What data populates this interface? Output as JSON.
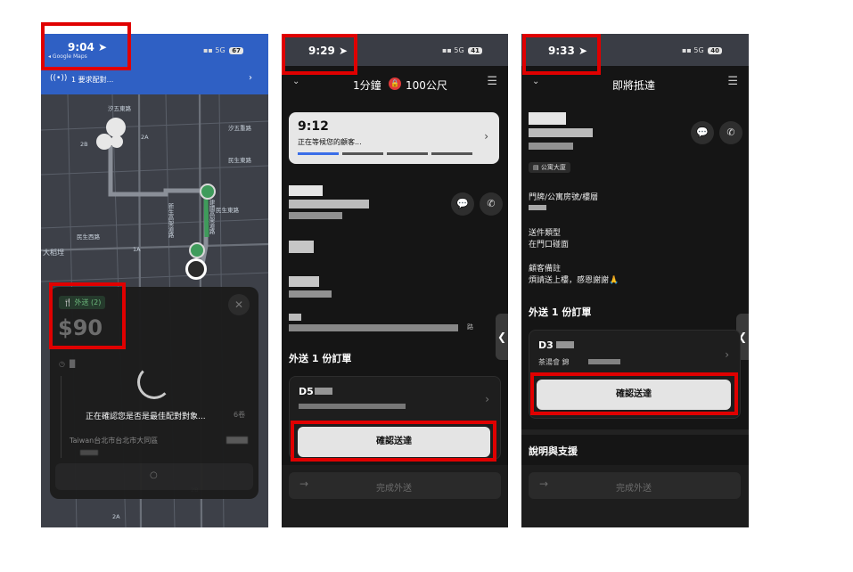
{
  "screen1": {
    "status_time": "9:04",
    "status_sub": "◂ Google Maps",
    "signal": "5G",
    "battery": "67",
    "banner_text": "1 要求配對...",
    "map_labels": [
      "汐五東路",
      "汐五重路",
      "民生東路",
      "民生東路",
      "民生西路",
      "大稻埕",
      "新生高架道路",
      "建國高架道路",
      "2B",
      "2A",
      "1A",
      "2B",
      "2A"
    ],
    "offer_tag": "外送 (2)",
    "offer_price": "$90",
    "confirming_text": "正在確認您是否是最佳配對對象...",
    "trip_count": "6卷",
    "address_text": "Taiwan台北市台北市大同區"
  },
  "screen2": {
    "status_time": "9:29",
    "signal": "5G",
    "battery": "41",
    "header_title": "1分鐘",
    "header_distance": "100公尺",
    "wait_time": "9:12",
    "wait_text": "正在等候您的顧客...",
    "orders_title": "外送 1 份訂單",
    "order_code": "D5",
    "address_tail": "路",
    "confirm_label": "確認送達",
    "complete_label": "完成外送"
  },
  "screen3": {
    "status_time": "9:33",
    "signal": "5G",
    "battery": "40",
    "header_title": "即將抵達",
    "building_tag": "公寓大廈",
    "door_label": "門牌/公寓房號/樓層",
    "dropoff_type_label": "送件類型",
    "dropoff_type_value": "在門口碰面",
    "notes_label": "顧客備註",
    "notes_value": "煩請送上樓，感恩謝謝🙏",
    "orders_title": "外送 1 份訂單",
    "order_code": "D3",
    "store_name": "茶湯會 錦",
    "confirm_label": "確認送達",
    "help_title": "說明與支援",
    "complete_label": "完成外送"
  },
  "colors": {
    "highlight": "#e00000",
    "app_dark": "#151515",
    "map_bg": "#3d4048",
    "banner_blue": "#2f60c4",
    "route_green": "#3f9b5b",
    "progress_blue": "#3a6ee8"
  }
}
